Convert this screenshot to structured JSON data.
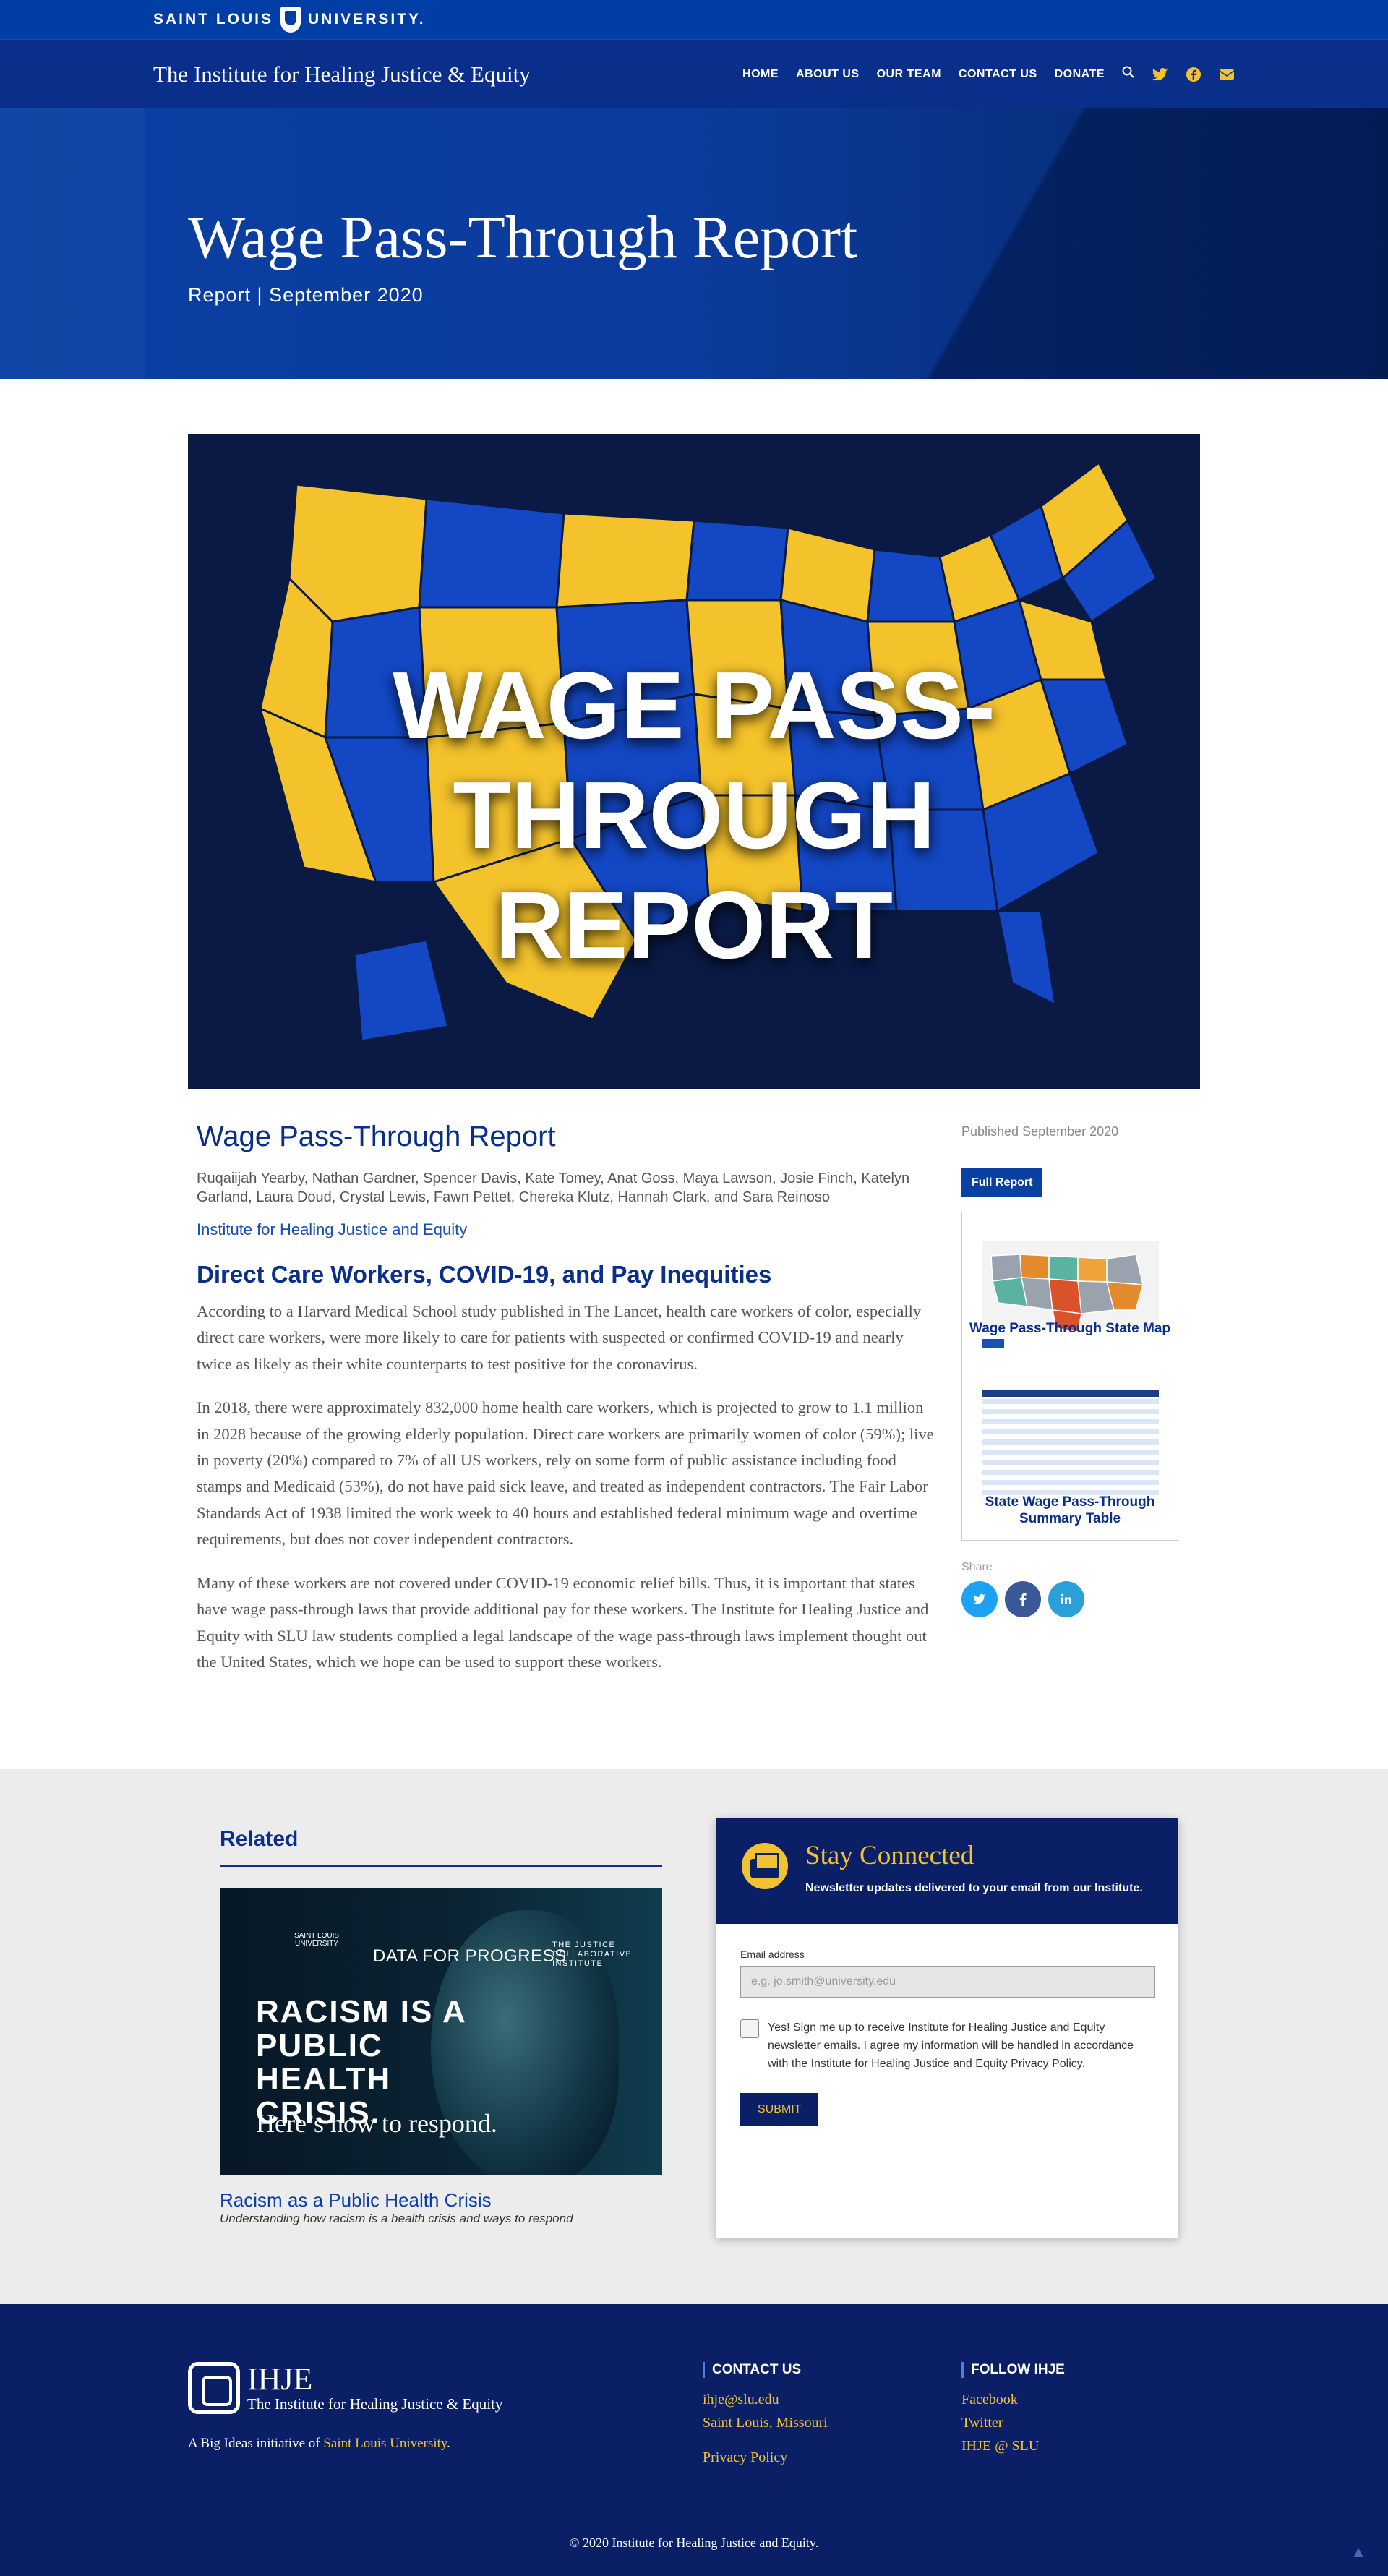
{
  "slu": {
    "name_part1": "SAINT LOUIS",
    "name_part2": "UNIVERSITY."
  },
  "header": {
    "site_title": "The Institute for Healing Justice & Equity",
    "nav": [
      "HOME",
      "ABOUT US",
      "OUR TEAM",
      "CONTACT US",
      "DONATE"
    ],
    "icons": [
      "search-icon",
      "twitter-icon",
      "facebook-icon",
      "email-icon"
    ]
  },
  "hero": {
    "title": "Wage Pass-Through Report",
    "subtitle": "Report | September 2020"
  },
  "feature": {
    "line1": "WAGE PASS-THROUGH",
    "line2": "REPORT"
  },
  "article": {
    "title": "Wage Pass-Through Report",
    "authors": "Ruqaiijah Yearby, Nathan Gardner, Spencer Davis, Kate Tomey, Anat Goss, Maya Lawson, Josie Finch, Katelyn Garland, Laura Doud, Crystal Lewis, Fawn Pettet, Chereka Klutz, Hannah Clark, and Sara Reinoso",
    "institute_link": "Institute for Healing Justice and Equity",
    "section_heading": "Direct Care Workers, COVID-19, and Pay Inequities",
    "paragraphs": [
      "According to a Harvard Medical School study published in The Lancet, health care workers of color, especially direct care workers, were more likely to care for patients with suspected or confirmed COVID-19 and nearly twice as likely as their white counterparts to test positive for the coronavirus.",
      "In 2018, there were approximately 832,000 home health care workers, which is projected to grow to 1.1 million in 2028 because of the growing elderly population. Direct care workers are primarily women of color (59%); live in poverty (20%) compared to 7% of all US workers, rely on some form of public assistance including food stamps and Medicaid (53%), do not have paid sick leave, and treated as independent contractors. The Fair Labor Standards Act of 1938 limited the work week to 40 hours and established federal minimum wage and overtime requirements, but does not cover independent contractors.",
      "Many of these workers are not covered under COVID-19 economic relief bills.  Thus, it is important that states have wage pass-through laws that provide additional pay for these workers.  The Institute for Healing Justice and Equity with SLU law students complied a legal landscape of the wage pass-through laws implement thought out the United States, which we hope can be used to support these workers."
    ]
  },
  "sidebar": {
    "published": "Published September 2020",
    "full_report_button": "Full Report",
    "thumb_label_1": "Wage Pass-Through State Map",
    "thumb_label_2": "State Wage Pass-Through Summary Table",
    "share_label": "Share",
    "share_icons": [
      "twitter-icon",
      "facebook-icon",
      "linkedin-icon"
    ]
  },
  "related": {
    "heading": "Related",
    "image_brand_1": "SAINT LOUIS UNIVERSITY",
    "image_brand_2": "DATA FOR PROGRESS",
    "image_brand_3": "THE JUSTICE COLLABORATIVE INSTITUTE",
    "image_headline": "RACISM IS A PUBLIC HEALTH CRISIS.",
    "image_tagline": "Here’s how to respond.",
    "title": "Racism as a Public Health Crisis",
    "description": "Understanding how racism is a health crisis and ways to respond"
  },
  "newsletter": {
    "heading": "Stay Connected",
    "description": "Newsletter updates delivered to your email from our Institute.",
    "email_label": "Email address",
    "email_placeholder": "e.g. jo.smith@university.edu",
    "consent": "Yes! Sign me up to receive Institute for Healing Justice and Equity newsletter emails. I agree my information will be handled in accordance with the Institute for Healing Justice and Equity Privacy Policy.",
    "submit": "SUBMIT"
  },
  "footer": {
    "logo_short": "IHJE",
    "logo_full": "The Institute for Healing Justice & Equity",
    "bigideas_prefix": "A Big Ideas initiative of ",
    "bigideas_link": "Saint Louis University",
    "bigideas_suffix": ".",
    "contact_heading": "CONTACT US",
    "contact_email": "ihje@slu.edu",
    "contact_location": "Saint Louis, Missouri",
    "privacy": "Privacy Policy",
    "follow_heading": "FOLLOW IHJE",
    "follow_links": [
      "Facebook",
      "Twitter",
      "IHJE @ SLU"
    ],
    "copyright": "© 2020 Institute for Healing Justice and Equity."
  },
  "colors": {
    "navy": "#0a1f66",
    "brand_blue": "#0a3fa3",
    "gold": "#f1c232"
  }
}
